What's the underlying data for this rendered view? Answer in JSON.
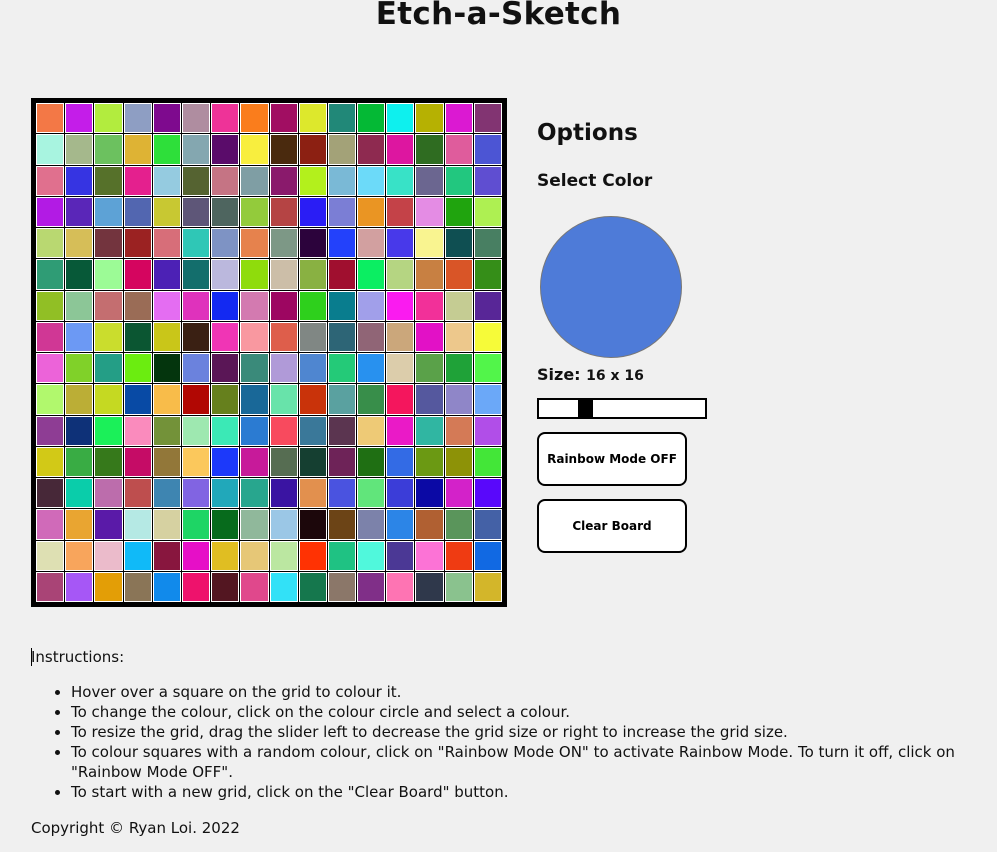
{
  "title": "Etch-a-Sketch",
  "options": {
    "heading": "Options",
    "select_color_label": "Select Color",
    "selected_color": "#4e7bd8",
    "size_label": "Size:",
    "size_value": "16 x 16",
    "slider_fraction": 0.26,
    "rainbow_button": "Rainbow Mode OFF",
    "clear_button": "Clear Board"
  },
  "instructions": {
    "heading": "Instructions:",
    "items": [
      "Hover over a square on the grid to colour it.",
      "To change the colour, click on the colour circle and select a colour.",
      "To resize the grid, drag the slider left to decrease the grid size or right to increase the grid size.",
      "To colour squares with a random colour, click on \"Rainbow Mode ON\" to activate Rainbow Mode. To turn it off, click on \"Rainbow Mode OFF\".",
      "To start with a new grid, click on the \"Clear Board\" button."
    ]
  },
  "copyright": "Copyright © Ryan Loi. 2022",
  "grid": {
    "size": 16,
    "colors": [
      "#f37846",
      "#c41de9",
      "#b2ec3e",
      "#8e9ec3",
      "#7e0a8e",
      "#af8da0",
      "#ee3398",
      "#fa7d1c",
      "#a10e62",
      "#dde82c",
      "#218878",
      "#04b935",
      "#0ef0ee",
      "#b6b102",
      "#db19d2",
      "#823472",
      "#a8f4e0",
      "#a5b88c",
      "#6cc15f",
      "#deb334",
      "#2edf3a",
      "#84a7b0",
      "#5a0c6a",
      "#f8ee3e",
      "#4a2a0e",
      "#8c2012",
      "#a3a278",
      "#8e2a50",
      "#dd16a0",
      "#2f6c21",
      "#df5c9c",
      "#4c55d4",
      "#e0708e",
      "#3634e2",
      "#56712a",
      "#e4208e",
      "#95cbe0",
      "#556331",
      "#c57484",
      "#7f9ea4",
      "#8a1a6c",
      "#b3f01c",
      "#7ab9d6",
      "#6cdaf9",
      "#38e2c7",
      "#6b6690",
      "#22c77f",
      "#5f4ed1",
      "#b21be4",
      "#5a26b8",
      "#5da2d6",
      "#5266b0",
      "#c8c832",
      "#5e5678",
      "#4e655f",
      "#93cb3b",
      "#b54444",
      "#2a1df5",
      "#7b7ed5",
      "#ea9523",
      "#c44248",
      "#e48ce4",
      "#20a40e",
      "#aef052",
      "#b9d871",
      "#d6be58",
      "#73343e",
      "#9b2222",
      "#d76e79",
      "#2fc7b6",
      "#7e93c4",
      "#e6824d",
      "#7d9886",
      "#2c033c",
      "#2341fb",
      "#d2a0a0",
      "#4839ea",
      "#f9f490",
      "#0f4f52",
      "#487f62",
      "#2f9c75",
      "#075938",
      "#9cfb96",
      "#d5055f",
      "#4c21b5",
      "#136e6c",
      "#bbb8dd",
      "#8fdc0c",
      "#ccbea8",
      "#89b142",
      "#a00f2f",
      "#0bee62",
      "#b5d582",
      "#c88042",
      "#d95527",
      "#358e18",
      "#91bf25",
      "#8cc697",
      "#c46e70",
      "#9a6c56",
      "#e46df2",
      "#df32bc",
      "#1329f2",
      "#d37ab0",
      "#9d0661",
      "#2ed01c",
      "#097d8e",
      "#a19fea",
      "#fa1bf0",
      "#f23099",
      "#c5cc93",
      "#582697",
      "#d03795",
      "#6c99f4",
      "#cadd2d",
      "#0b5632",
      "#c9c619",
      "#3a2013",
      "#f035b5",
      "#f998a0",
      "#de5e4b",
      "#808784",
      "#2d6576",
      "#906576",
      "#cba77b",
      "#e211c6",
      "#edc88c",
      "#f6fb39",
      "#ec63d9",
      "#80d129",
      "#249e86",
      "#6bed10",
      "#04350d",
      "#6b82dd",
      "#5a1656",
      "#3a8a7a",
      "#b09ad8",
      "#4f86d0",
      "#24ca78",
      "#2891ef",
      "#dccdab",
      "#5aa149",
      "#1fa238",
      "#52f54a",
      "#b1f86d",
      "#bbae36",
      "#c5d922",
      "#084aa5",
      "#f8bc4a",
      "#b10703",
      "#66801d",
      "#196898",
      "#68e3aa",
      "#c9330a",
      "#5aa1a0",
      "#388e4a",
      "#f4165d",
      "#55589e",
      "#8f86c8",
      "#6ba8f8",
      "#8e3d94",
      "#0e3178",
      "#1bf059",
      "#fa8bbd",
      "#739239",
      "#9ee8b0",
      "#3be9b6",
      "#2b7bd2",
      "#f84a5e",
      "#3a7899",
      "#5b3550",
      "#eeca76",
      "#ea1ac7",
      "#30b6a2",
      "#d47a56",
      "#b14ee8",
      "#d2c917",
      "#39ac44",
      "#36791b",
      "#c50c66",
      "#927739",
      "#fbc85c",
      "#1c39fa",
      "#c71a9a",
      "#566d52",
      "#153f31",
      "#6e2358",
      "#1f6f13",
      "#336be5",
      "#6b9913",
      "#8d9207",
      "#43e638",
      "#472838",
      "#0acdaa",
      "#bc6dac",
      "#be4e4e",
      "#3e85b1",
      "#8164e2",
      "#21a8ba",
      "#28a68e",
      "#3a14a2",
      "#e2904e",
      "#4a53e0",
      "#61e57b",
      "#3b3dd8",
      "#0b09a5",
      "#d322c9",
      "#5908fb",
      "#d06ab9",
      "#e9a531",
      "#5a1aa8",
      "#b5e9e4",
      "#d6d1a1",
      "#1ed565",
      "#076b1c",
      "#90b89b",
      "#9bc7e6",
      "#1c070b",
      "#6c4416",
      "#7c82aa",
      "#2c85e7",
      "#b06032",
      "#5a955b",
      "#4461a6",
      "#dee0b3",
      "#f8a55c",
      "#ebbbcb",
      "#10baf8",
      "#88163e",
      "#e60fc7",
      "#e0be22",
      "#e6c777",
      "#bbe7a1",
      "#ff3203",
      "#1fc283",
      "#50f8dc",
      "#4b3895",
      "#fc73d6",
      "#ef3b12",
      "#1169e3",
      "#a94476",
      "#a657f6",
      "#e39e06",
      "#8a7557",
      "#118aeb",
      "#ee126c",
      "#531621",
      "#e0488c",
      "#32e1f7",
      "#15774d",
      "#8b7769",
      "#802f88",
      "#fe74b3",
      "#2f384b",
      "#8ac28e",
      "#d3b62a"
    ]
  }
}
